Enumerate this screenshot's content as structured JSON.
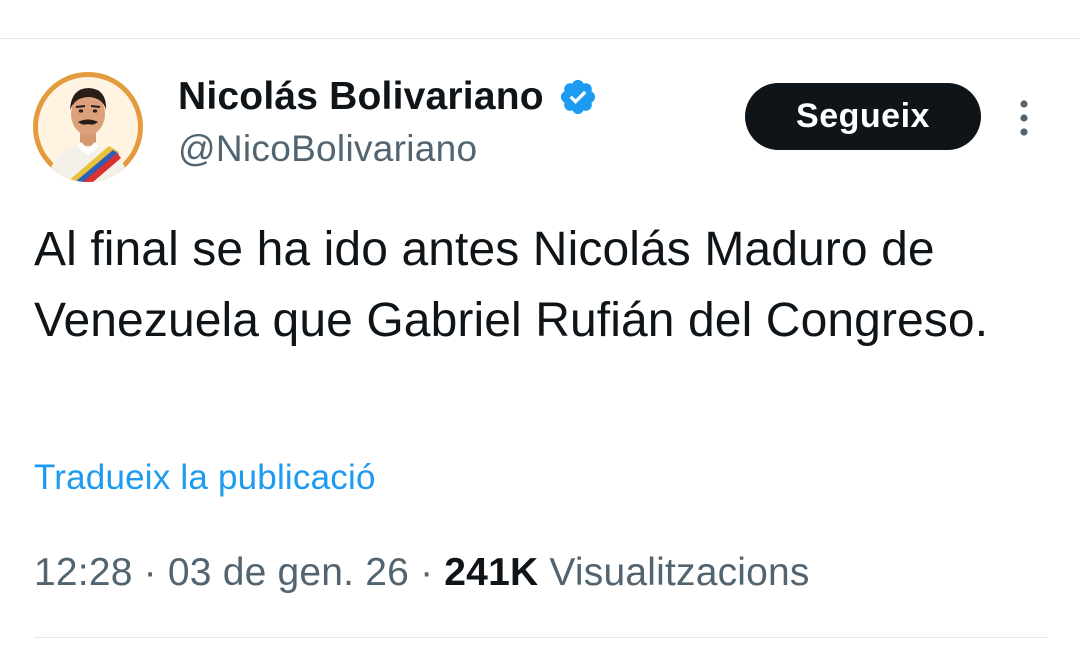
{
  "user": {
    "display_name": "Nicolás Bolivariano",
    "handle": "@NicoBolivariano",
    "verified": true,
    "avatar_icon": "cartoon-portrait-avatar"
  },
  "follow_button": {
    "label": "Segueix"
  },
  "more_menu_icon": "vertical-ellipsis-icon",
  "tweet": {
    "text": "Al final se ha ido antes Nicolás Maduro de Venezuela que Gabriel Rufián del Congreso."
  },
  "translate_link": "Tradueix la publicació",
  "meta": {
    "time": "12:28",
    "separator": " · ",
    "date": "03 de gen. 26",
    "views_count": "241K",
    "views_label": " Visualitzacions"
  },
  "colors": {
    "text_primary": "#0f1419",
    "text_secondary": "#536471",
    "link": "#1d9bf0",
    "verified_badge": "#1d9bf0",
    "button_bg": "#0f1419",
    "divider": "#e4e8eb"
  }
}
